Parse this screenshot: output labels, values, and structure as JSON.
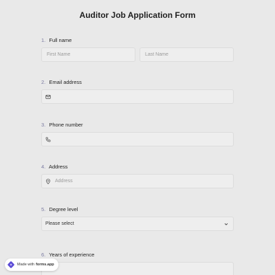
{
  "form": {
    "title": "Auditor Job Application Form"
  },
  "questions": {
    "q1": {
      "number": "1.",
      "label": "Full name",
      "first_placeholder": "First Name",
      "last_placeholder": "Last Name"
    },
    "q2": {
      "number": "2.",
      "label": "Email address",
      "icon": "mail-icon"
    },
    "q3": {
      "number": "3.",
      "label": "Phone number",
      "icon": "phone-icon"
    },
    "q4": {
      "number": "4.",
      "label": "Address",
      "placeholder": "Address",
      "icon": "location-pin-icon"
    },
    "q5": {
      "number": "5.",
      "label": "Degree level",
      "selected": "Please select",
      "icon": "chevron-down-icon"
    },
    "q6": {
      "number": "6.",
      "label": "Years of experience"
    }
  },
  "badge": {
    "prefix": "Made with",
    "brand": "forms.app",
    "icon": "forms-app-logo"
  },
  "colors": {
    "background": "#e9e9e9",
    "field_bg": "#eeeeee",
    "number": "#7a7aa0",
    "logo": "#5b4bd6"
  }
}
